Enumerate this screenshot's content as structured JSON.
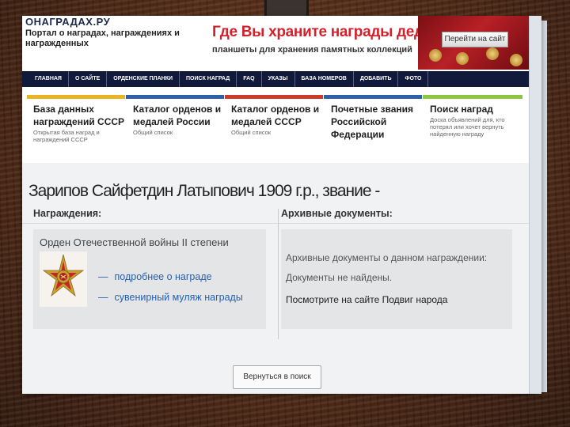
{
  "site": {
    "logo": "ОНАГРАДАХ.РУ",
    "tagline": "Портал о наградах, награждениях и награжденных"
  },
  "promo": {
    "title": "Где Вы храните награды деда?",
    "subtitle": "планшеты для хранения памятных коллекций",
    "button": "Перейти на сайт"
  },
  "nav": {
    "items": [
      "ГЛАВНАЯ",
      "О САЙТЕ",
      "ОРДЕНСКИЕ ПЛАНКИ",
      "ПОИСК НАГРАД",
      "FAQ",
      "УКАЗЫ",
      "БАЗА НОМЕРОВ",
      "ДОБАВИТЬ",
      "ФОТО"
    ]
  },
  "categories": [
    {
      "title": "База данных награждений СССР",
      "subtitle": "Открытая база наград и награждений СССР",
      "color": "#e8b520"
    },
    {
      "title": "Каталог орденов и медалей России",
      "subtitle": "Общий список",
      "color": "#2f5fa8"
    },
    {
      "title": "Каталог орденов и медалей СССР",
      "subtitle": "Общий список",
      "color": "#cc3a2a"
    },
    {
      "title": "Почетные звания Российской Федерации",
      "subtitle": "",
      "color": "#2f5fa8"
    },
    {
      "title": "Поиск наград",
      "subtitle": "Доска объявлений для, кто потерял или хочет вернуть найденную награду",
      "color": "#8dc63f"
    }
  ],
  "person": {
    "heading": "Зарипов Сайфетдин Латыпович 1909 г.р., звание -"
  },
  "awards": {
    "label": "Награждения:",
    "title": "Орден Отечественной войны II степени",
    "link1": "подробнее о награде",
    "link2": "сувенирный муляж награды",
    "dash": "—"
  },
  "archive": {
    "label": "Архивные документы:",
    "line1": "Архивные документы о данном награждении:",
    "line2": "Документы не найдены.",
    "line3": "Посмотрите на сайте Подвиг народа"
  },
  "back_button": "Вернуться в поиск",
  "colors": {
    "nav_bg": "#111a3a",
    "promo_red": "#d4202a",
    "link_blue": "#2860b0"
  }
}
